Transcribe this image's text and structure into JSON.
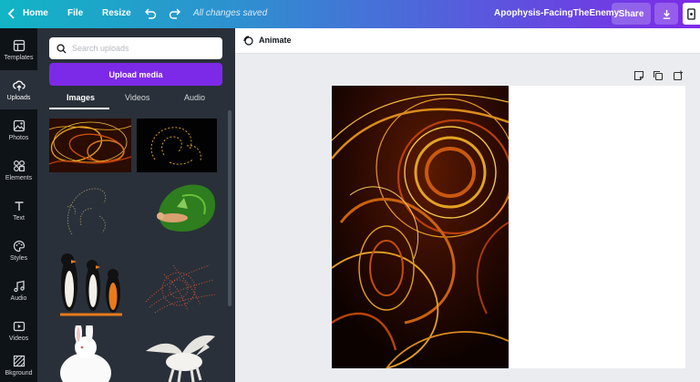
{
  "topbar": {
    "home": "Home",
    "file": "File",
    "resize": "Resize",
    "saved_status": "All changes saved",
    "doc_title": "Apophysis-FacingTheEnemy",
    "share": "Share"
  },
  "rail": [
    {
      "label": "Templates",
      "icon": "templates-icon"
    },
    {
      "label": "Uploads",
      "icon": "upload-icon",
      "active": true
    },
    {
      "label": "Photos",
      "icon": "photo-icon"
    },
    {
      "label": "Elements",
      "icon": "elements-icon"
    },
    {
      "label": "Text",
      "icon": "text-icon"
    },
    {
      "label": "Styles",
      "icon": "palette-icon"
    },
    {
      "label": "Audio",
      "icon": "music-icon"
    },
    {
      "label": "Videos",
      "icon": "video-icon"
    },
    {
      "label": "Bkground",
      "icon": "background-icon"
    }
  ],
  "panel": {
    "search_placeholder": "Search uploads",
    "upload_button": "Upload media",
    "tabs": [
      "Images",
      "Videos",
      "Audio"
    ],
    "active_tab": "Images"
  },
  "editor": {
    "animate": "Animate"
  },
  "colors": {
    "accent": "#7d2ae8",
    "sidebar": "#293039",
    "rail": "#0e1318"
  }
}
